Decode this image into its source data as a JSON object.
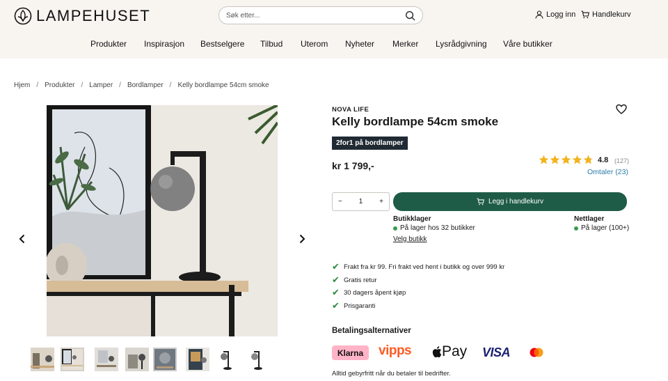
{
  "header": {
    "logo_text": "LAMPEHUSET",
    "search_placeholder": "Søk etter...",
    "login_label": "Logg inn",
    "cart_label": "Handlekurv"
  },
  "nav": [
    "Produkter",
    "Inspirasjon",
    "Bestselgere",
    "Tilbud",
    "Uterom",
    "Nyheter",
    "Merker",
    "Lysrådgivning",
    "Våre butikker"
  ],
  "breadcrumb": [
    "Hjem",
    "Produkter",
    "Lamper",
    "Bordlamper",
    "Kelly bordlampe 54cm smoke"
  ],
  "product": {
    "brand": "NOVA LIFE",
    "title": "Kelly bordlampe 54cm smoke",
    "promo": "2for1 på bordlamper",
    "price": "kr 1 799,-",
    "rating": "4.8",
    "rating_value": 4.8,
    "rating_count": "(127)",
    "reviews_link": "Omtaler (23)",
    "quantity": "1",
    "add_to_cart": "Legg i handlekurv"
  },
  "stock": {
    "store_title": "Butikklager",
    "store_status": "På lager hos 32 butikker",
    "choose_store": "Velg butikk",
    "online_title": "Nettlager",
    "online_status": "På lager (100+)"
  },
  "usps": [
    "Frakt fra kr 99. Fri frakt ved hent i butikk og over 999 kr",
    "Gratis retur",
    "30 dagers åpent kjøp",
    "Prisgaranti"
  ],
  "payment": {
    "title": "Betalingsalternativer",
    "methods": [
      "Klarna",
      "vipps",
      "Pay",
      "VISA"
    ],
    "note": "Alltid gebyrfritt når du betaler til bedrifter."
  },
  "colors": {
    "header_bg": "#f8f5f1",
    "cta_green": "#1f5c47",
    "promo_dark": "#1f2a33",
    "link_blue": "#2c7aa8",
    "stock_green": "#3a9b4e",
    "star_gold": "#f2b31c"
  },
  "icons": [
    "logo-icon",
    "search-icon",
    "user-icon",
    "cart-icon",
    "heart-icon",
    "star-icon",
    "chevron-left-icon",
    "chevron-right-icon",
    "minus-icon",
    "plus-icon",
    "check-icon",
    "apple-icon",
    "mastercard-icon"
  ]
}
